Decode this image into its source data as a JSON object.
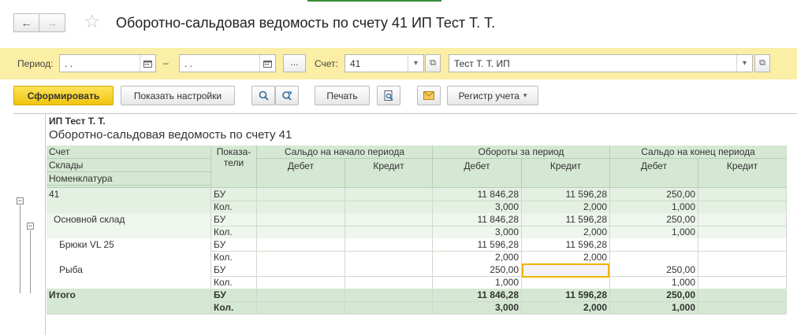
{
  "window": {
    "title": "Оборотно-сальдовая ведомость по счету 41 ИП Тест Т. Т.",
    "nav_back": "←",
    "nav_forward": "→",
    "favorite_icon": "star-icon"
  },
  "filters": {
    "period_label": "Период:",
    "period_from": " .  .",
    "period_to": " .  .",
    "dash": "–",
    "period_more": "...",
    "account_label": "Счет:",
    "account_value": "41",
    "org_value": "Тест Т. Т. ИП"
  },
  "toolbar": {
    "generate": "Сформировать",
    "show_settings": "Показать настройки",
    "print": "Печать",
    "register": "Регистр учета"
  },
  "report": {
    "org": "ИП Тест Т. Т.",
    "heading": "Оборотно-сальдовая ведомость по счету 41",
    "hier_headers": [
      "Счет",
      "Склады",
      "Номенклатура"
    ],
    "indicators_header": "Показа-\nтели",
    "groups": [
      "Сальдо на начало периода",
      "Обороты за период",
      "Сальдо на конец периода"
    ],
    "debit": "Дебет",
    "credit": "Кредит",
    "rows": [
      {
        "name": "41",
        "kind": "account",
        "lines": [
          {
            "ind": "БУ",
            "v": [
              "",
              "",
              "11 846,28",
              "11 596,28",
              "250,00",
              ""
            ]
          },
          {
            "ind": "Кол.",
            "v": [
              "",
              "",
              "3,000",
              "2,000",
              "1,000",
              ""
            ]
          }
        ]
      },
      {
        "name": "Основной склад",
        "kind": "warehouse",
        "lines": [
          {
            "ind": "БУ",
            "v": [
              "",
              "",
              "11 846,28",
              "11 596,28",
              "250,00",
              ""
            ]
          },
          {
            "ind": "Кол.",
            "v": [
              "",
              "",
              "3,000",
              "2,000",
              "1,000",
              ""
            ]
          }
        ]
      },
      {
        "name": "Брюки VL 25",
        "kind": "item",
        "lines": [
          {
            "ind": "БУ",
            "v": [
              "",
              "",
              "11 596,28",
              "11 596,28",
              "",
              ""
            ]
          },
          {
            "ind": "Кол.",
            "v": [
              "",
              "",
              "2,000",
              "2,000",
              "",
              ""
            ]
          }
        ]
      },
      {
        "name": "Рыба",
        "kind": "item",
        "lines": [
          {
            "ind": "БУ",
            "v": [
              "",
              "",
              "250,00",
              "",
              "250,00",
              ""
            ]
          },
          {
            "ind": "Кол.",
            "v": [
              "",
              "",
              "1,000",
              "",
              "1,000",
              ""
            ]
          }
        ]
      },
      {
        "name": "Итого",
        "kind": "total",
        "lines": [
          {
            "ind": "БУ",
            "v": [
              "",
              "",
              "11 846,28",
              "11 596,28",
              "250,00",
              ""
            ]
          },
          {
            "ind": "Кол.",
            "v": [
              "",
              "",
              "3,000",
              "2,000",
              "1,000",
              ""
            ]
          }
        ]
      }
    ]
  }
}
